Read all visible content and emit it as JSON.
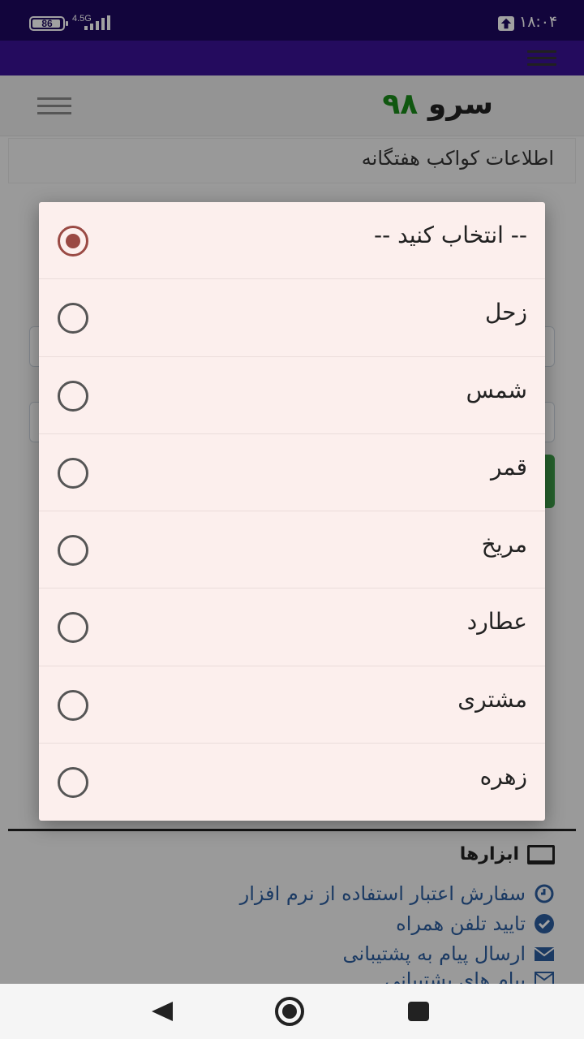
{
  "status_bar": {
    "battery": "86",
    "network": "4.5G",
    "time": "۱۸:۰۴"
  },
  "header": {
    "logo_text": "سرو",
    "logo_number": "۹۸"
  },
  "page_title": "اطلاعات کواکب هفتگانه",
  "dialog": {
    "options": [
      {
        "label": "-- انتخاب کنید --",
        "selected": true
      },
      {
        "label": "زحل",
        "selected": false
      },
      {
        "label": "شمس",
        "selected": false
      },
      {
        "label": "قمر",
        "selected": false
      },
      {
        "label": "مریخ",
        "selected": false
      },
      {
        "label": "عطارد",
        "selected": false
      },
      {
        "label": "مشتری",
        "selected": false
      },
      {
        "label": "زهره",
        "selected": false
      }
    ]
  },
  "footer": {
    "heading": "ابزارها",
    "links": [
      {
        "label": "سفارش اعتبار استفاده از نرم افزار",
        "icon": "clock-icon"
      },
      {
        "label": "تایید تلفن همراه",
        "icon": "check-circle-icon"
      },
      {
        "label": "ارسال پیام به پشتیبانی",
        "icon": "envelope-icon"
      },
      {
        "label": "پیام های پشتیبانی",
        "icon": "envelope-outline-icon"
      }
    ]
  },
  "colors": {
    "status_bar": "#1e0860",
    "app_bar": "#3a1296",
    "radio_selected": "#9a4a44",
    "dialog_bg": "#fcefed",
    "link": "#2b5c9e"
  }
}
